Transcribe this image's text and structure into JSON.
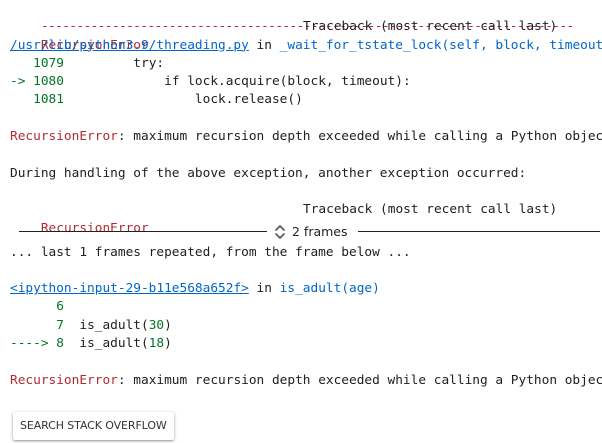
{
  "traceback1": {
    "dashes": "---------------------------------------------------------------------------",
    "error_name": "RecursionError",
    "traceback_label": "Traceback (most recent call last)",
    "file_path": "/usr/lib/python3.9/threading.py",
    "in_word": " in ",
    "func_name": "_wait_for_tstate_lock",
    "func_args": "(self, block, timeout)",
    "lines": [
      {
        "prefix": "   ",
        "lineno": "1079",
        "code": "         try:"
      },
      {
        "prefix": "-> ",
        "lineno": "1080",
        "code": "             if lock.acquire(block, timeout):"
      },
      {
        "prefix": "   ",
        "lineno": "1081",
        "code": "                 lock.release()"
      }
    ],
    "message_name": "RecursionError",
    "message_text": ": maximum recursion depth exceeded while calling a Python object"
  },
  "during_handling": "During handling of the above exception, another exception occurred:",
  "traceback2": {
    "error_name": "RecursionError",
    "traceback_label": "Traceback (most recent call last)",
    "frames_toggle_label": "2 frames",
    "repeated_note": "... last 1 frames repeated, from the frame below ...",
    "input_link": "<ipython-input-29-b11e568a652f>",
    "in_word": " in ",
    "func_name": "is_adult",
    "func_args": "(age)",
    "lines": [
      {
        "prefix": "      ",
        "lineno": "6",
        "code": "",
        "arg": "",
        "close": ""
      },
      {
        "prefix": "      ",
        "lineno": "7",
        "code": "  is_adult(",
        "arg": "30",
        "close": ")"
      },
      {
        "prefix": "----> ",
        "lineno": "8",
        "code": "  is_adult(",
        "arg": "18",
        "close": ")"
      }
    ],
    "message_name": "RecursionError",
    "message_text": ": maximum recursion depth exceeded while calling a Python object"
  },
  "search_button_label": "SEARCH STACK OVERFLOW",
  "colors": {
    "error_red": "#b22b31",
    "line_green": "#007427",
    "link_blue": "#0065ca"
  }
}
